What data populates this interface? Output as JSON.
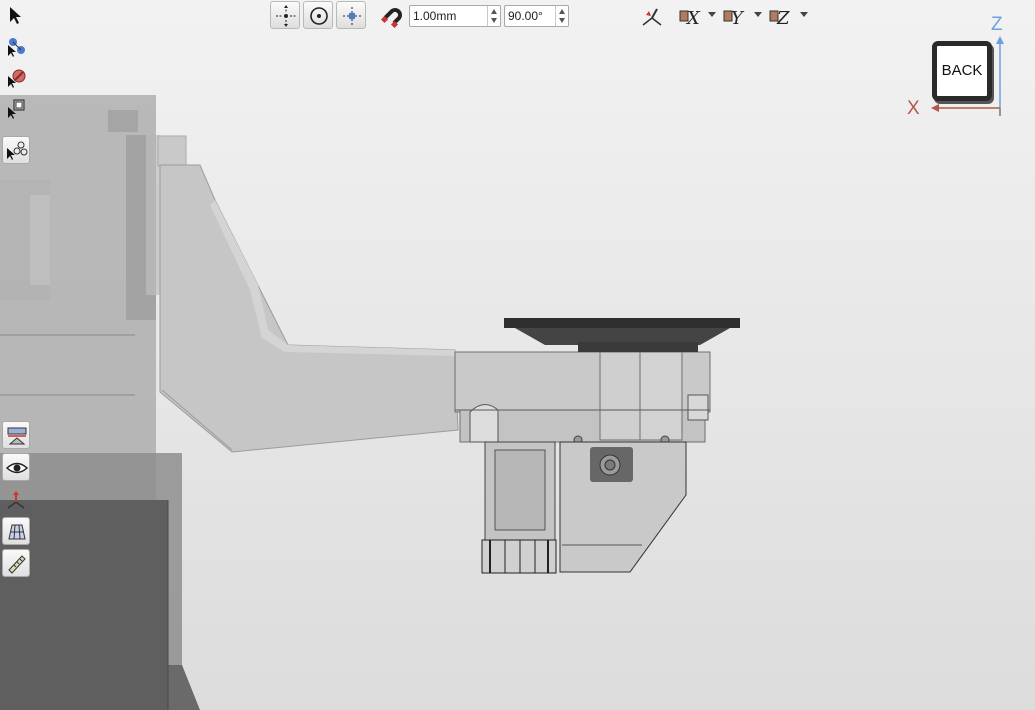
{
  "toolbar": {
    "snap_distance_value": "1.00mm",
    "snap_angle_value": "90.00°",
    "tools": [
      "move-tool",
      "rotate-tool",
      "align-tool",
      "snap-magnet",
      "view-orient",
      "mirror-x",
      "mirror-y",
      "mirror-z"
    ]
  },
  "left_tools": [
    "select-tool",
    "select-path-tool",
    "deselect-tool",
    "select-boundary-tool",
    "select-connected-tool",
    "section-view-tool",
    "visibility-tool",
    "orient-tool",
    "grid-tool",
    "measure-tool"
  ],
  "view_cube": {
    "face_label": "BACK",
    "axis_x": "X",
    "axis_z": "Z",
    "x_color": "#b2594a",
    "z_color": "#6f9fe0"
  },
  "colors": {
    "background": "#e8e8e8",
    "part_gray": "#c8c8c8",
    "dark_gray": "#5a5a5a",
    "plate": "#2f2f2f"
  }
}
